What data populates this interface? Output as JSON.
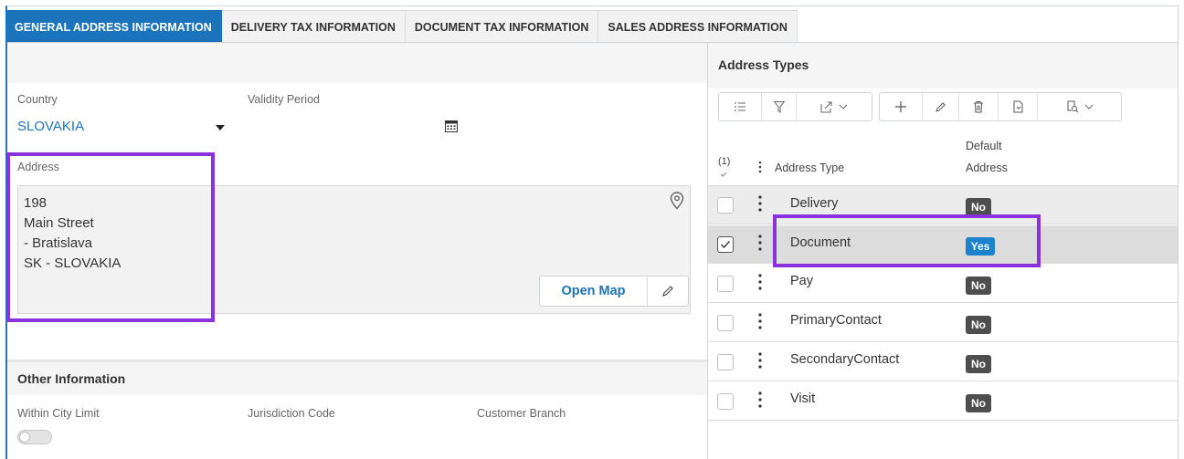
{
  "tabs": [
    {
      "label": "GENERAL ADDRESS INFORMATION",
      "active": true
    },
    {
      "label": "DELIVERY TAX INFORMATION",
      "active": false
    },
    {
      "label": "DOCUMENT TAX INFORMATION",
      "active": false
    },
    {
      "label": "SALES ADDRESS INFORMATION",
      "active": false
    }
  ],
  "general": {
    "country_label": "Country",
    "country_value": "SLOVAKIA",
    "validity_label": "Validity Period",
    "address_label": "Address",
    "address_lines": [
      "198",
      "Main Street",
      "- Bratislava",
      "SK - SLOVAKIA"
    ],
    "open_map_label": "Open Map"
  },
  "other": {
    "title": "Other Information",
    "within_city_label": "Within City Limit",
    "jurisdiction_label": "Jurisdiction Code",
    "customer_branch_label": "Customer Branch",
    "within_city_on": false
  },
  "address_types": {
    "title": "Address Types",
    "selected_count": "(1)",
    "col_address_type": "Address Type",
    "col_default_line1": "Default",
    "col_default_line2": "Address",
    "rows": [
      {
        "type": "Delivery",
        "default": "No",
        "checked": false
      },
      {
        "type": "Document",
        "default": "Yes",
        "checked": true
      },
      {
        "type": "Pay",
        "default": "No",
        "checked": false
      },
      {
        "type": "PrimaryContact",
        "default": "No",
        "checked": false
      },
      {
        "type": "SecondaryContact",
        "default": "No",
        "checked": false
      },
      {
        "type": "Visit",
        "default": "No",
        "checked": false
      }
    ]
  },
  "colors": {
    "accent": "#1b74bb",
    "highlight": "#8b31de",
    "badge_no": "#4e4e4e",
    "badge_yes": "#1b82cc"
  }
}
